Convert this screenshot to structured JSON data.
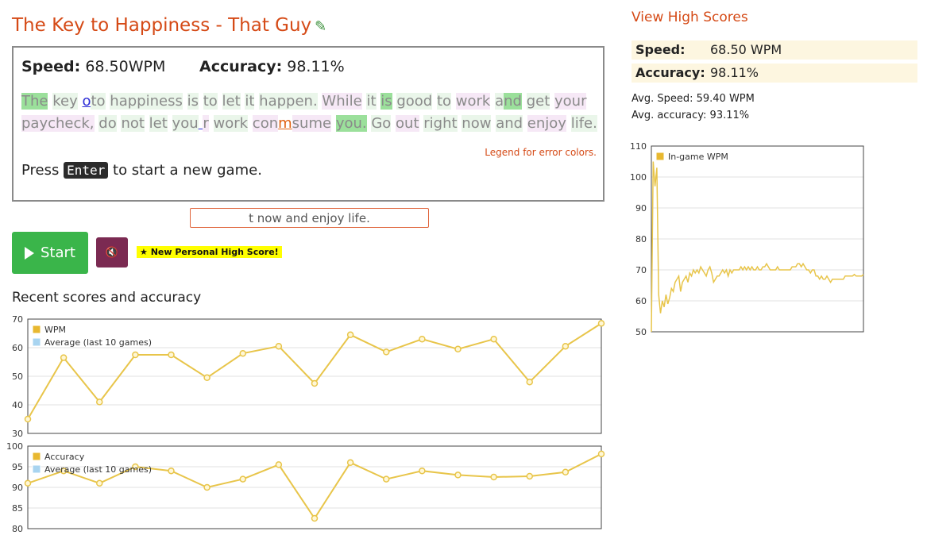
{
  "header": {
    "title": "The Key to Happiness - That Guy",
    "edit_icon": "pencil-icon"
  },
  "game": {
    "speed_label": "Speed:",
    "speed_value": "68.50WPM",
    "accuracy_label": "Accuracy:",
    "accuracy_value": "98.11%",
    "passage": [
      {
        "t": "The",
        "s": "g"
      },
      {
        "t": " ",
        "s": ""
      },
      {
        "t": "key",
        "s": "w"
      },
      {
        "t": " ",
        "s": ""
      },
      {
        "t": "o",
        "s": "miss"
      },
      {
        "t": "to",
        "s": "w"
      },
      {
        "t": " ",
        "s": ""
      },
      {
        "t": "happiness",
        "s": "w"
      },
      {
        "t": " ",
        "s": ""
      },
      {
        "t": "is",
        "s": "w"
      },
      {
        "t": " ",
        "s": ""
      },
      {
        "t": "to",
        "s": "w"
      },
      {
        "t": " ",
        "s": ""
      },
      {
        "t": "let",
        "s": "w"
      },
      {
        "t": " ",
        "s": ""
      },
      {
        "t": "it",
        "s": "w"
      },
      {
        "t": " ",
        "s": ""
      },
      {
        "t": "happen.",
        "s": "w"
      },
      {
        "t": " ",
        "s": ""
      },
      {
        "t": "While",
        "s": "p"
      },
      {
        "t": " ",
        "s": ""
      },
      {
        "t": "it",
        "s": "w"
      },
      {
        "t": " ",
        "s": ""
      },
      {
        "t": "is",
        "s": "g"
      },
      {
        "t": " ",
        "s": ""
      },
      {
        "t": "good",
        "s": "w"
      },
      {
        "t": " ",
        "s": ""
      },
      {
        "t": "to",
        "s": "w"
      },
      {
        "t": " ",
        "s": ""
      },
      {
        "t": "work",
        "s": "p"
      },
      {
        "t": " ",
        "s": ""
      },
      {
        "t": "a",
        "s": "w"
      },
      {
        "t": "nd",
        "s": "g"
      },
      {
        "t": " ",
        "s": ""
      },
      {
        "t": "get",
        "s": "w"
      },
      {
        "t": " ",
        "s": ""
      },
      {
        "t": "your",
        "s": "p"
      },
      {
        "t": " ",
        "s": ""
      },
      {
        "t": "paycheck,",
        "s": "p"
      },
      {
        "t": " ",
        "s": ""
      },
      {
        "t": "do",
        "s": "w"
      },
      {
        "t": " ",
        "s": ""
      },
      {
        "t": "not",
        "s": "w"
      },
      {
        "t": " ",
        "s": ""
      },
      {
        "t": "let",
        "s": "w"
      },
      {
        "t": " ",
        "s": ""
      },
      {
        "t": "you",
        "s": "w"
      },
      {
        "t": " ",
        "s": "miss"
      },
      {
        "t": "r",
        "s": "p"
      },
      {
        "t": " ",
        "s": ""
      },
      {
        "t": "work",
        "s": "w"
      },
      {
        "t": " ",
        "s": ""
      },
      {
        "t": "con",
        "s": "p"
      },
      {
        "t": "m",
        "s": "err"
      },
      {
        "t": "sume",
        "s": "p"
      },
      {
        "t": " ",
        "s": ""
      },
      {
        "t": "you.",
        "s": "g"
      },
      {
        "t": " ",
        "s": ""
      },
      {
        "t": "Go",
        "s": "w"
      },
      {
        "t": " ",
        "s": ""
      },
      {
        "t": "out",
        "s": "p"
      },
      {
        "t": " ",
        "s": ""
      },
      {
        "t": "right",
        "s": "w"
      },
      {
        "t": " ",
        "s": ""
      },
      {
        "t": "now",
        "s": "w"
      },
      {
        "t": " ",
        "s": ""
      },
      {
        "t": "and",
        "s": "w"
      },
      {
        "t": " ",
        "s": ""
      },
      {
        "t": "enjoy",
        "s": "p"
      },
      {
        "t": " ",
        "s": ""
      },
      {
        "t": "life.",
        "s": "w"
      }
    ],
    "legend_link": "Legend for error colors.",
    "press_before": "Press",
    "press_key": "Enter",
    "press_after": "to start a new game."
  },
  "input": {
    "value": "t now and enjoy life."
  },
  "controls": {
    "start_label": "Start",
    "mute_icon": "speaker-mute-icon",
    "mute_glyph": "🔇",
    "badge": "★ New Personal High Score!"
  },
  "recent": {
    "title": "Recent scores and accuracy"
  },
  "sidebar": {
    "view_high_scores": "View High Scores",
    "speed_label": "Speed:",
    "speed_value": "68.50 WPM",
    "accuracy_label": "Accuracy:",
    "accuracy_value": "98.11%",
    "avg_speed": "Avg. Speed: 59.40 WPM",
    "avg_accuracy": "Avg. accuracy: 93.11%"
  },
  "colors": {
    "line": "#e8c54a",
    "legend_main": "#e8b830",
    "legend_avg": "#a8d4f0",
    "accent": "#d54a16"
  },
  "chart_data": [
    {
      "type": "line",
      "id": "wpm",
      "series": [
        {
          "name": "WPM",
          "values": [
            35,
            56.5,
            41,
            57.5,
            57.5,
            49.5,
            58,
            60.5,
            47.5,
            64.5,
            58.5,
            63,
            59.5,
            63,
            48,
            60.5,
            68.5
          ]
        },
        {
          "name": "Average (last 10 games)",
          "values": []
        }
      ],
      "ylim": [
        30,
        70
      ],
      "yticks": [
        30,
        40,
        50,
        60,
        70
      ]
    },
    {
      "type": "line",
      "id": "accuracy",
      "series": [
        {
          "name": "Accuracy",
          "values": [
            91,
            94,
            91,
            95,
            94,
            90,
            92,
            95.5,
            82.5,
            96,
            92,
            94,
            93,
            92.5,
            92.7,
            93.7,
            98.1
          ]
        },
        {
          "name": "Average (last 10 games)",
          "values": []
        }
      ],
      "ylim": [
        80,
        100
      ],
      "yticks": [
        80,
        85,
        90,
        95,
        100
      ]
    },
    {
      "type": "line",
      "id": "ingame",
      "series": [
        {
          "name": "In-game WPM",
          "values": [
            50,
            105,
            97,
            103,
            62,
            56,
            60,
            58,
            62,
            59,
            61,
            64,
            63,
            66,
            67,
            68,
            63,
            66,
            67,
            68,
            66,
            69,
            68,
            70,
            69,
            70,
            69,
            71,
            70,
            69,
            68,
            70,
            71,
            69,
            66,
            67,
            68,
            68,
            69,
            70,
            69,
            70,
            68,
            70,
            69,
            70,
            70,
            70,
            70,
            71,
            70,
            71,
            70,
            71,
            70,
            71,
            70,
            70,
            71,
            70,
            70,
            71,
            71,
            72,
            71,
            70,
            70,
            70,
            70,
            71,
            70,
            70,
            70,
            70,
            70,
            70,
            70,
            71,
            71,
            71,
            72,
            72,
            71,
            72,
            71,
            70,
            70,
            69,
            70,
            70,
            68,
            68,
            67,
            68,
            67,
            67,
            68,
            67,
            66,
            67,
            67,
            67,
            67,
            67,
            67,
            67,
            68,
            68,
            68,
            68,
            68,
            68.5,
            68,
            68,
            68,
            68,
            68.5
          ]
        }
      ],
      "ylim": [
        50,
        110
      ],
      "yticks": [
        50,
        60,
        70,
        80,
        90,
        100,
        110
      ]
    }
  ]
}
